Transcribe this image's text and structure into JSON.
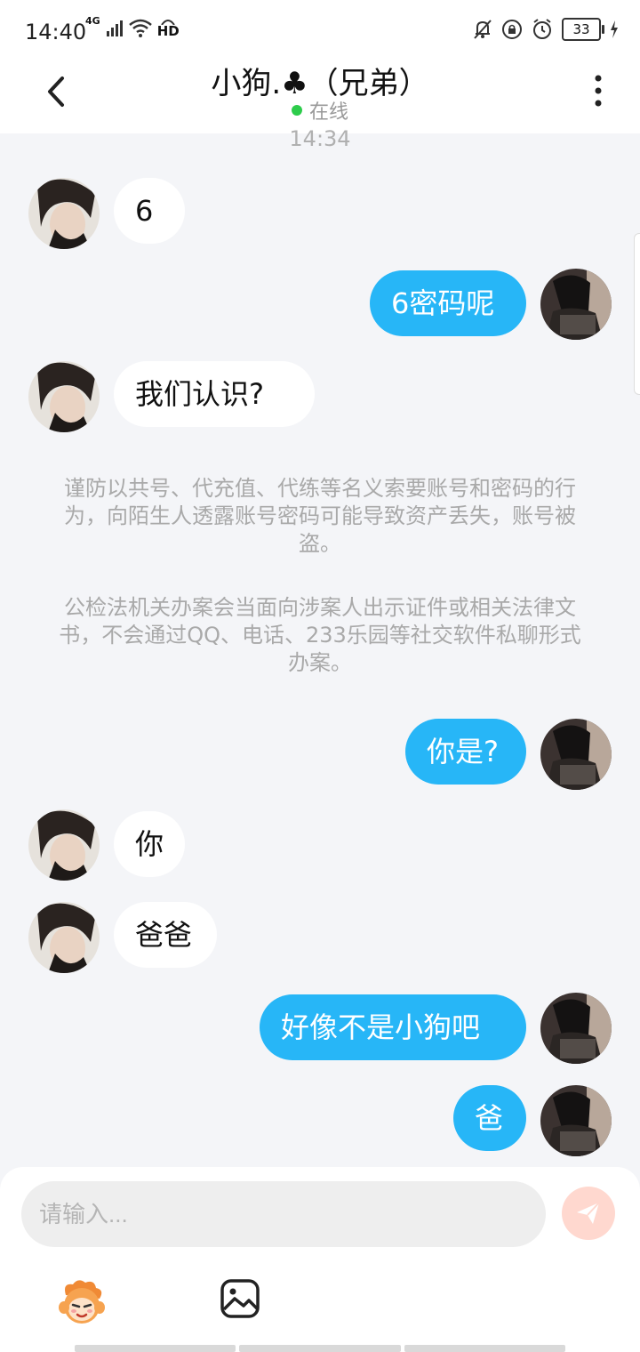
{
  "status_bar": {
    "time": "14:40",
    "network": "4G",
    "hd": "HD",
    "battery": "33"
  },
  "header": {
    "title": "小狗.♣（兄弟）",
    "status": "在线"
  },
  "chat": {
    "timestamp": "14:34",
    "messages": [
      {
        "side": "in",
        "text": "6"
      },
      {
        "side": "out",
        "text": "6密码呢"
      },
      {
        "side": "in",
        "text": "我们认识?"
      },
      {
        "side": "out",
        "text": "你是?"
      },
      {
        "side": "in",
        "text": "你"
      },
      {
        "side": "in",
        "text": "爸爸"
      },
      {
        "side": "out",
        "text": "好像不是小狗吧"
      },
      {
        "side": "out",
        "text": "爸"
      }
    ],
    "notice_1": "谨防以共号、代充值、代练等名义索要账号和密码的行为，向陌生人透露账号密码可能导致资产丢失，账号被盗。",
    "notice_2": "公检法机关办案会当面向涉案人出示证件或相关法律文书，不会通过QQ、电话、233乐园等社交软件私聊形式办案。"
  },
  "input": {
    "placeholder": "请输入..."
  },
  "colors": {
    "accent": "#27b6f7",
    "online": "#2dcc4b",
    "send_disabled": "#ffd8cf",
    "background": "#f4f5f8"
  },
  "icons": {
    "back": "chevron-left-icon",
    "menu": "more-vertical-icon",
    "send": "send-icon",
    "emoji": "mascot-emoji-icon",
    "image": "image-icon"
  }
}
